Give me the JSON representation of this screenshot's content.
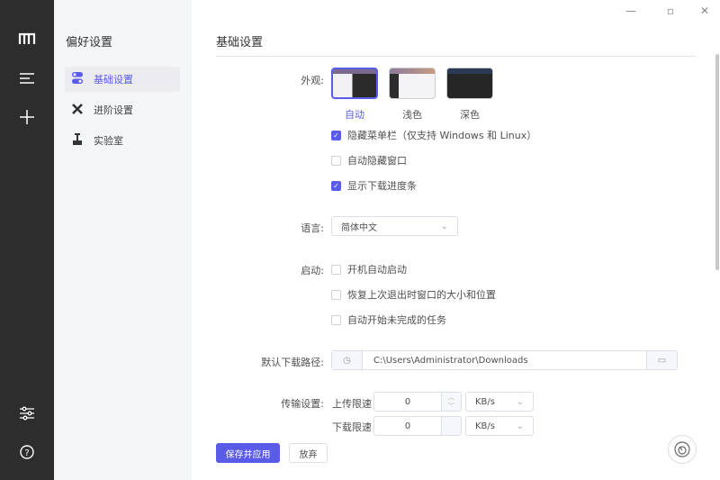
{
  "rail": {
    "icons": [
      "logo-icon",
      "task-list-icon",
      "add-icon",
      "preferences-icon",
      "help-icon"
    ]
  },
  "nav": {
    "title": "偏好设置",
    "items": [
      {
        "label": "基础设置",
        "active": true
      },
      {
        "label": "进阶设置"
      },
      {
        "label": "实验室"
      }
    ]
  },
  "main": {
    "title": "基础设置",
    "appearance": {
      "label": "外观:",
      "options": [
        "自动",
        "浅色",
        "深色"
      ],
      "selected": "自动"
    },
    "checks1": [
      {
        "label": "隐藏菜单栏（仅支持 Windows 和 Linux）",
        "checked": true
      },
      {
        "label": "自动隐藏窗口",
        "checked": false
      },
      {
        "label": "显示下载进度条",
        "checked": true
      }
    ],
    "language": {
      "label": "语言:",
      "value": "简体中文"
    },
    "startup": {
      "label": "启动:",
      "options": [
        {
          "label": "开机自动启动",
          "checked": false
        },
        {
          "label": "恢复上次退出时窗口的大小和位置",
          "checked": false
        },
        {
          "label": "自动开始未完成的任务",
          "checked": false
        }
      ]
    },
    "download_path": {
      "label": "默认下载路径:",
      "value": "C:\\Users\\Administrator\\Downloads"
    },
    "transfer": {
      "label": "传输设置:",
      "upload_label": "上传限速",
      "upload_value": "0",
      "upload_unit": "KB/s",
      "download_label": "下载限速",
      "download_value": "0",
      "download_unit": "KB/s"
    }
  },
  "footer": {
    "save": "保存并应用",
    "discard": "放弃"
  },
  "colors": {
    "accent": "#5b5bea"
  }
}
